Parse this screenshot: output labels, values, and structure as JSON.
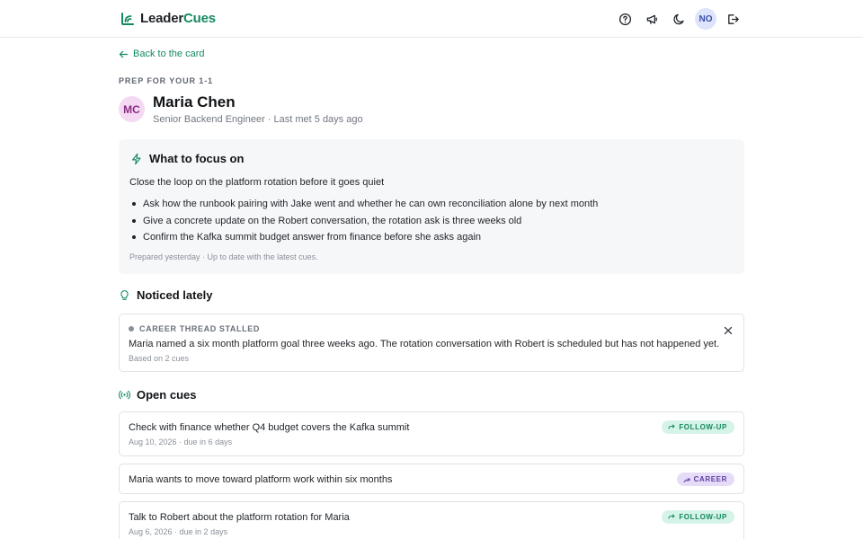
{
  "brand": {
    "name_part1": "Leader",
    "name_part2": "Cues"
  },
  "header": {
    "user_initials": "NO"
  },
  "nav": {
    "back_label": "Back to the card"
  },
  "prep": {
    "eyebrow": "PREP FOR YOUR 1-1",
    "initials": "MC",
    "name": "Maria Chen",
    "subtitle": "Senior Backend Engineer · Last met 5 days ago"
  },
  "focus": {
    "title": "What to focus on",
    "lead": "Close the loop on the platform rotation before it goes quiet",
    "items": [
      "Ask how the runbook pairing with Jake went and whether he can own reconciliation alone by next month",
      "Give a concrete update on the Robert conversation, the rotation ask is three weeks old",
      "Confirm the Kafka summit budget answer from finance before she asks again"
    ],
    "footer": "Prepared yesterday · Up to date with the latest cues."
  },
  "noticed": {
    "title": "Noticed lately",
    "card": {
      "kicker": "CAREER THREAD STALLED",
      "body": "Maria named a six month platform goal three weeks ago. The rotation conversation with Robert is scheduled but has not happened yet.",
      "meta": "Based on 2 cues"
    }
  },
  "cues": {
    "title": "Open cues",
    "items": [
      {
        "text": "Check with finance whether Q4 budget covers the Kafka summit",
        "meta": "Aug 10, 2026 · due in 6 days",
        "tag": "FOLLOW-UP"
      },
      {
        "text": "Maria wants to move toward platform work within six months",
        "meta": "",
        "tag": "CAREER"
      },
      {
        "text": "Talk to Robert about the platform rotation for Maria",
        "meta": "Aug 6, 2026 · due in 2 days",
        "tag": "FOLLOW-UP"
      }
    ]
  },
  "colors": {
    "accent": "#13895f",
    "follow_up_bg": "#d6f3e8",
    "career_bg": "#e6dcf8",
    "card_bg": "#f6f7f9"
  }
}
